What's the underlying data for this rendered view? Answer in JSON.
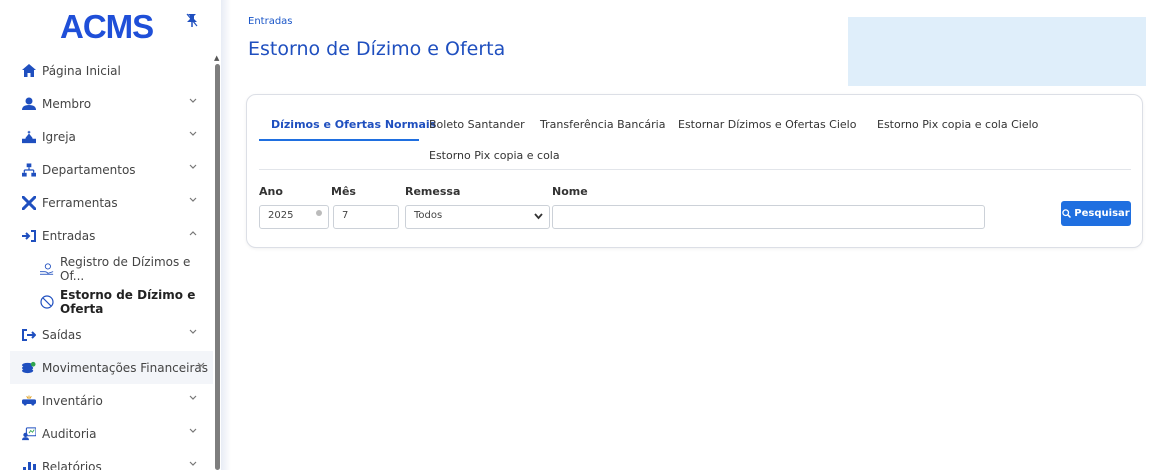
{
  "app": {
    "logo": "ACMS"
  },
  "sidebar": {
    "items": [
      {
        "label": "Página Inicial",
        "icon": "home-icon",
        "chevron": ""
      },
      {
        "label": "Membro",
        "icon": "user-icon",
        "chevron": "⌄"
      },
      {
        "label": "Igreja",
        "icon": "church-icon",
        "chevron": "⌄"
      },
      {
        "label": "Departamentos",
        "icon": "org-chart-icon",
        "chevron": "⌄"
      },
      {
        "label": "Ferramentas",
        "icon": "tools-icon",
        "chevron": "⌄"
      },
      {
        "label": "Entradas",
        "icon": "sign-in-icon",
        "chevron": "⌃"
      },
      {
        "label": "Registro de Dízimos e Of...",
        "icon": "hand-coin-icon",
        "chevron": ""
      },
      {
        "label": "Estorno de Dízimo e Oferta",
        "icon": "ban-icon",
        "chevron": ""
      },
      {
        "label": "Saídas",
        "icon": "sign-out-icon",
        "chevron": "⌄"
      },
      {
        "label": "Movimentações Financeiras",
        "icon": "coins-icon",
        "chevron": "⌄"
      },
      {
        "label": "Inventário",
        "icon": "inventory-icon",
        "chevron": "⌄"
      },
      {
        "label": "Auditoria",
        "icon": "audit-icon",
        "chevron": "⌄"
      },
      {
        "label": "Relatórios",
        "icon": "bar-chart-icon",
        "chevron": "⌄"
      }
    ]
  },
  "main": {
    "breadcrumb": "Entradas",
    "title": "Estorno de Dízimo e Oferta",
    "tabs": [
      "Dízimos e Ofertas Normais",
      "Boleto Santander",
      "Transferência Bancária",
      "Estornar Dízimos e Ofertas Cielo",
      "Estorno Pix copia e cola Cielo",
      "Estorno Pix copia e cola"
    ],
    "form": {
      "ano_label": "Ano",
      "ano_value": "2025",
      "mes_label": "Mês",
      "mes_value": "7",
      "remessa_label": "Remessa",
      "remessa_value": "Todos",
      "nome_label": "Nome",
      "nome_value": "",
      "search_button": "Pesquisar"
    }
  },
  "colors": {
    "accent": "#1f6fe0",
    "title": "#1f4fbf",
    "logo": "#1f4fd8",
    "banner": "#dfeefa"
  }
}
